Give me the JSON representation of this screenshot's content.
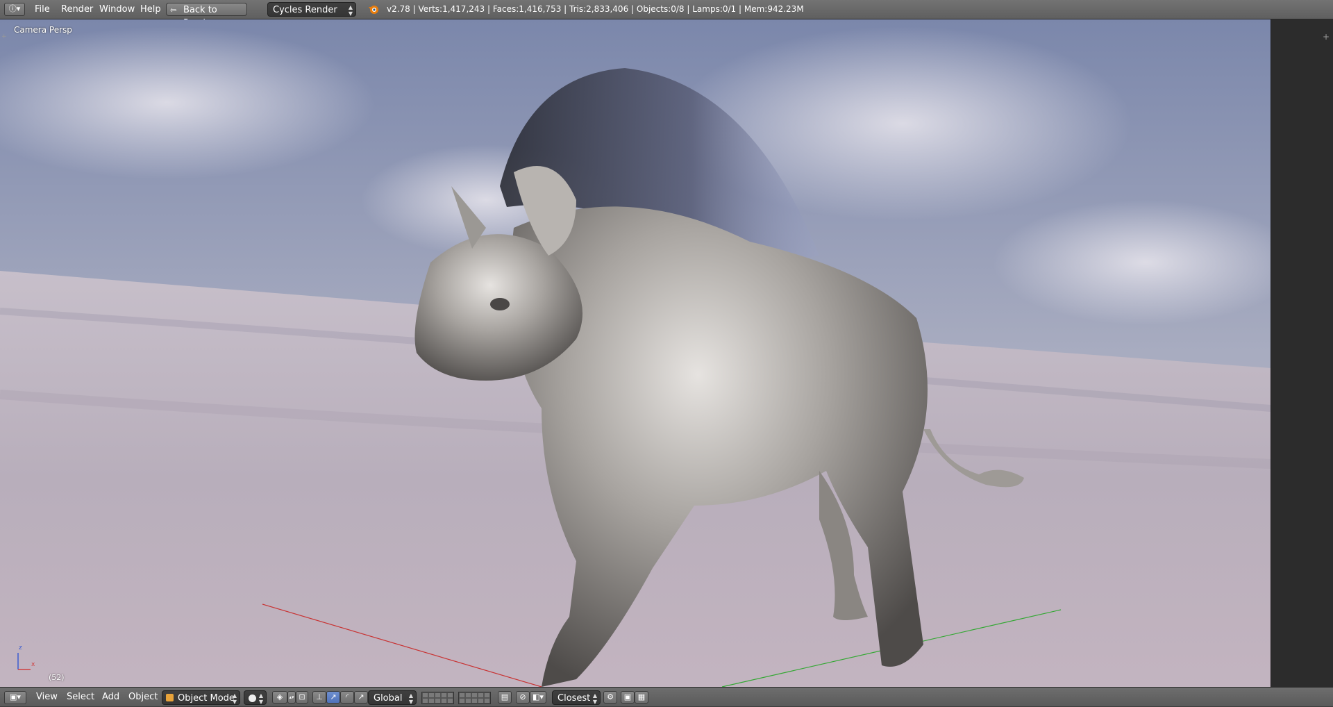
{
  "topbar": {
    "info_icon": "info-icon",
    "menus": [
      "File",
      "Render",
      "Window",
      "Help"
    ],
    "back_button_label": "Back to Previous",
    "engine_value": "Cycles Render",
    "stats": "v2.78 | Verts:1,417,243 | Faces:1,416,753 | Tris:2,833,406 | Objects:0/8 | Lamps:0/1 | Mem:942.23M"
  },
  "viewport": {
    "view_name": "Camera Persp",
    "frame_number": "(52)",
    "axis_labels": {
      "z": "z",
      "x": "x"
    }
  },
  "bottombar": {
    "menus": [
      "View",
      "Select",
      "Add",
      "Object"
    ],
    "mode_value": "Object Mode",
    "orientation_value": "Global",
    "snap_target_value": "Closest"
  },
  "colors": {
    "toolbar": "#6b6b6b",
    "dropdown": "#3a3a3a",
    "manipulator_active": "#5a7cc4",
    "x_axis": "#c83232",
    "y_axis": "#32a832"
  }
}
